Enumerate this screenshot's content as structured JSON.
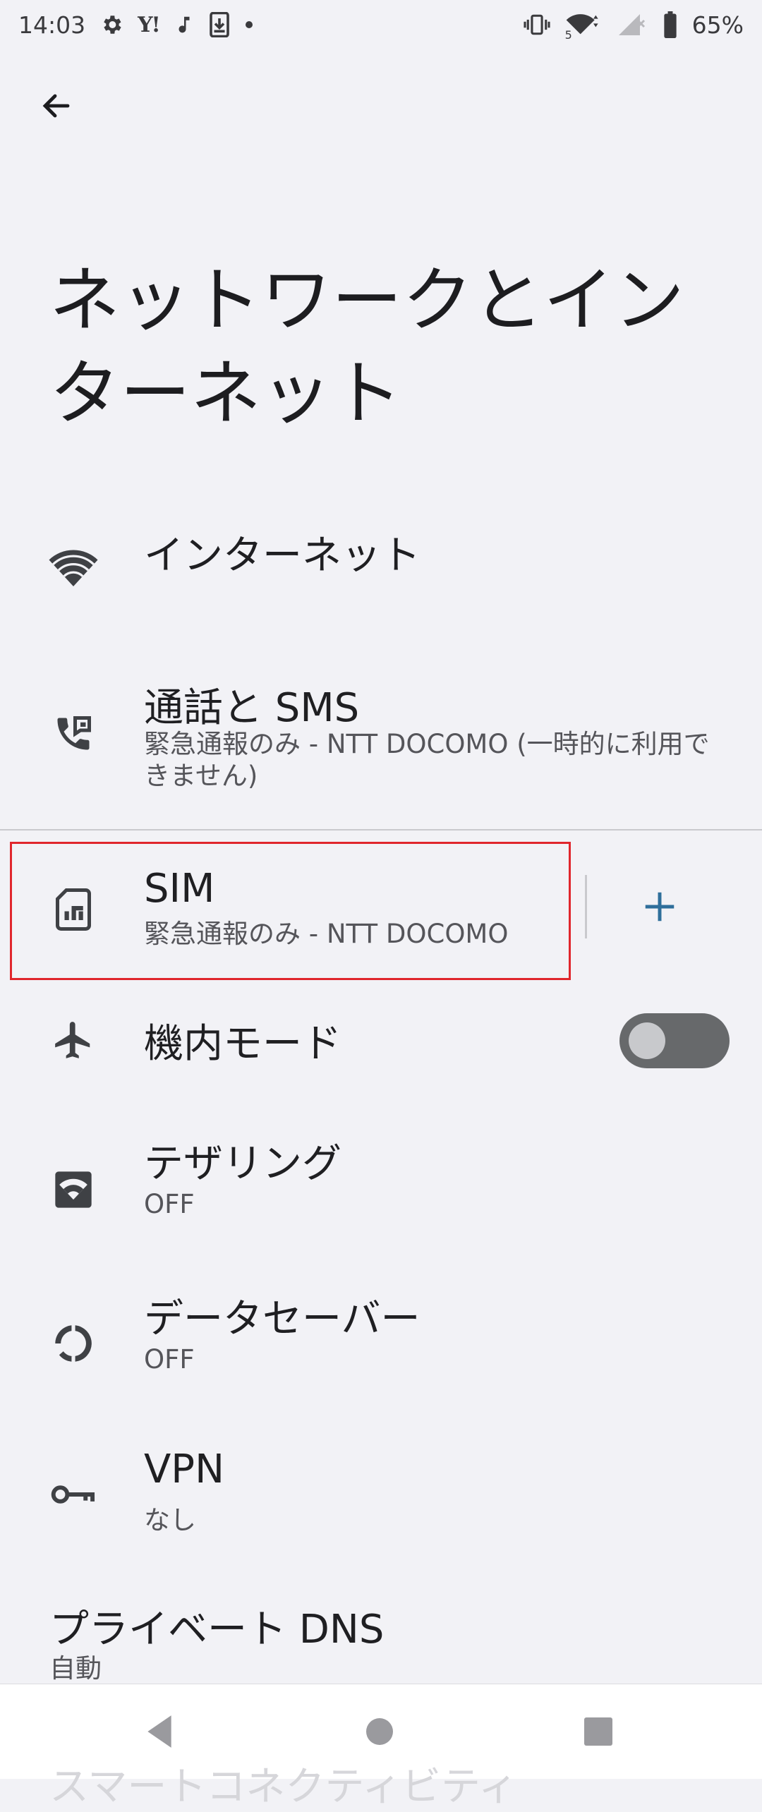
{
  "status_bar": {
    "time": "14:03",
    "yahoo": "Y!",
    "network_sub": "5",
    "battery": "65%",
    "icons": [
      "gear-icon",
      "yahoo-icon",
      "music-note-icon",
      "download-icon",
      "dot-icon",
      "vibrate-icon",
      "wifi-icon",
      "signal-icon",
      "battery-icon"
    ]
  },
  "header": {
    "back_icon": "arrow-left-icon",
    "title": "ネットワークとインターネット"
  },
  "items": {
    "internet": {
      "title": "インターネット",
      "icon": "wifi-icon"
    },
    "calls": {
      "title": "通話と SMS",
      "subtitle": "緊急通報のみ - NTT DOCOMO (一時的に利用できません)",
      "icon": "phone-sim-icon"
    },
    "sim": {
      "title": "SIM",
      "subtitle": "緊急通報のみ - NTT DOCOMO",
      "icon": "sim-card-icon",
      "action_icon": "plus-icon"
    },
    "airplane": {
      "title": "機内モード",
      "icon": "airplane-icon",
      "toggle_on": false
    },
    "tethering": {
      "title": "テザリング",
      "subtitle": "OFF",
      "icon": "hotspot-icon"
    },
    "data_saver": {
      "title": "データセーバー",
      "subtitle": "OFF",
      "icon": "data-saver-icon"
    },
    "vpn": {
      "title": "VPN",
      "subtitle": "なし",
      "icon": "key-icon"
    },
    "private_dns": {
      "title": "プライベート DNS",
      "subtitle": "自動"
    },
    "smart_connectivity": {
      "title": "スマートコネクティビティ"
    }
  },
  "nav_bar": {
    "icons": [
      "back-triangle-icon",
      "home-circle-icon",
      "recents-square-icon"
    ]
  },
  "colors": {
    "background": "#f2f2f6",
    "accent": "#2f6f9b",
    "highlight": "#e0262c",
    "toggle_track": "#67696b"
  }
}
